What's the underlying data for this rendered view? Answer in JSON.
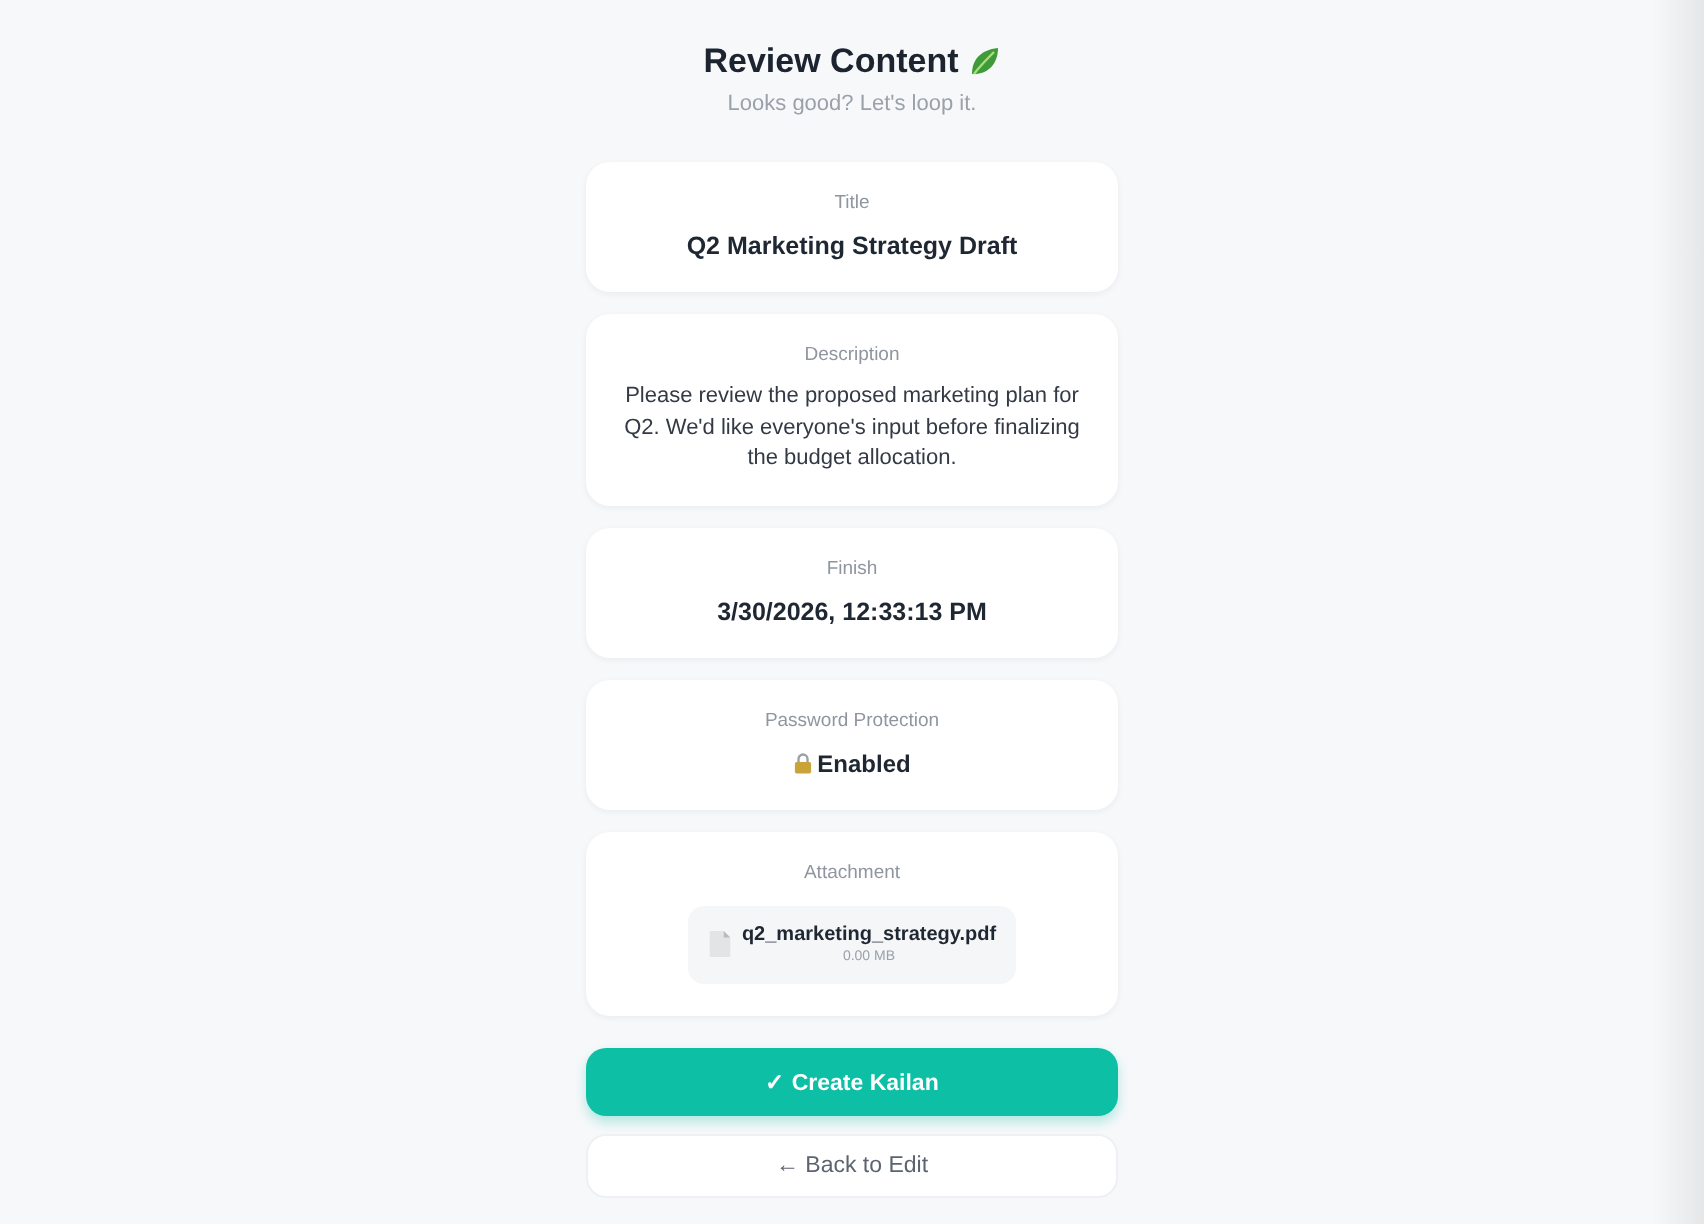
{
  "header": {
    "title": "Review Content",
    "subtitle": "Looks good? Let's loop it."
  },
  "fields": [
    {
      "kind": "text",
      "label": "Title",
      "value": "Q2 Marketing Strategy Draft"
    },
    {
      "kind": "paragraph",
      "label": "Description",
      "value": "Please review the proposed marketing plan for Q2. We'd like everyone's input before finalizing the budget allocation."
    },
    {
      "kind": "text",
      "label": "Finish",
      "value": "3/30/2026, 12:33:13 PM"
    },
    {
      "kind": "lock",
      "label": "Password Protection",
      "value": "Enabled"
    },
    {
      "kind": "file",
      "label": "Attachment",
      "file_name": "q2_marketing_strategy.pdf",
      "file_size": "0.00 MB"
    }
  ],
  "actions": [
    {
      "kind": "primary",
      "label": "✓ Create Kailan"
    },
    {
      "kind": "secondary",
      "label": "← Back to Edit"
    }
  ]
}
